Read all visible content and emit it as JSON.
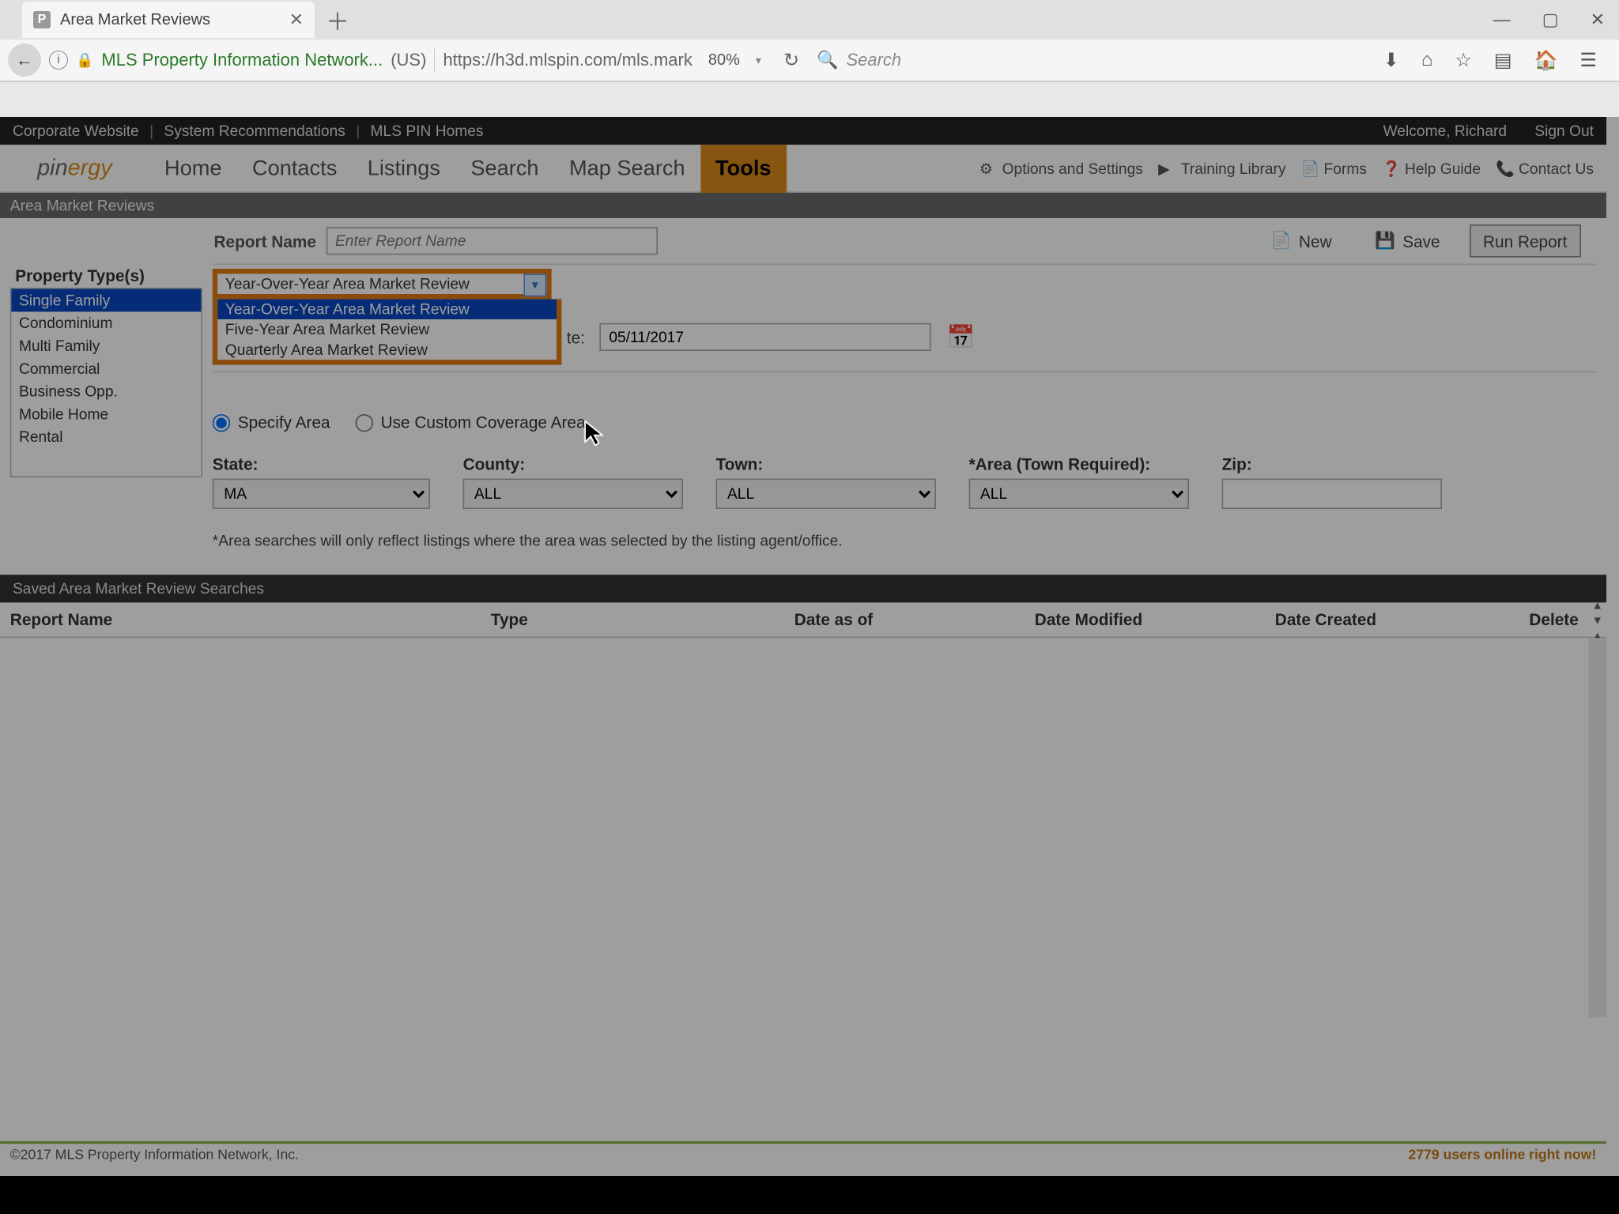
{
  "browser": {
    "tab_title": "Area Market Reviews",
    "site_identity": "MLS Property Information Network...",
    "site_country": "(US)",
    "url": "https://h3d.mlspin.com/mls.mark",
    "zoom": "80%",
    "search_placeholder": "Search"
  },
  "topbar": {
    "links": [
      "Corporate Website",
      "System Recommendations",
      "MLS PIN Homes"
    ],
    "welcome": "Welcome, Richard",
    "signout": "Sign Out"
  },
  "logo": {
    "part1": "pin",
    "part2": "ergy"
  },
  "nav": {
    "items": [
      "Home",
      "Contacts",
      "Listings",
      "Search",
      "Map Search",
      "Tools"
    ],
    "active_index": 5,
    "right": [
      "Options and Settings",
      "Training Library",
      "Forms",
      "Help Guide",
      "Contact Us"
    ]
  },
  "crumb": "Area Market Reviews",
  "report": {
    "label": "Report Name",
    "placeholder": "Enter Report Name",
    "actions": {
      "new": "New",
      "save": "Save",
      "run": "Run Report"
    }
  },
  "property_types": {
    "header": "Property Type(s)",
    "items": [
      "Single Family",
      "Condominium",
      "Multi Family",
      "Commercial",
      "Business Opp.",
      "Mobile Home",
      "Rental"
    ],
    "selected_index": 0
  },
  "dropdown": {
    "selected": "Year-Over-Year Area Market Review",
    "options": [
      "Year-Over-Year Area Market Review",
      "Five-Year Area Market Review",
      "Quarterly Area Market Review"
    ],
    "highlight_index": 0
  },
  "date": {
    "label_suffix": "te:",
    "value": "05/11/2017"
  },
  "area": {
    "specify": "Specify Area",
    "custom": "Use Custom Coverage Area"
  },
  "loc": {
    "state_label": "State:",
    "state_value": "MA",
    "county_label": "County:",
    "county_value": "ALL",
    "town_label": "Town:",
    "town_value": "ALL",
    "area_label": "*Area (Town Required):",
    "area_value": "ALL",
    "zip_label": "Zip:"
  },
  "note": "*Area searches will only reflect listings where the area was selected by the listing agent/office.",
  "saved": {
    "header": "Saved Area Market Review Searches"
  },
  "grid": {
    "cols": [
      "Report Name",
      "Type",
      "Date as of",
      "Date Modified",
      "Date Created",
      "Delete"
    ]
  },
  "footer": {
    "copyright": "©2017 MLS Property Information Network, Inc.",
    "online": "2779 users online right now!"
  }
}
